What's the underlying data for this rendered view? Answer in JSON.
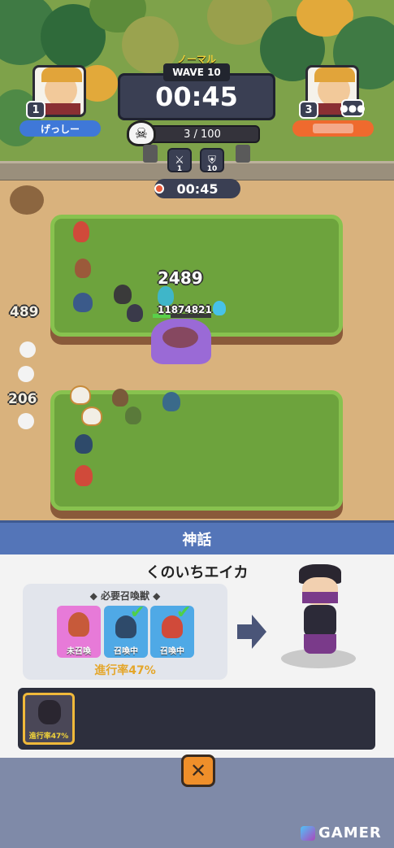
{
  "player1": {
    "name": "げっしー",
    "level": "1"
  },
  "player2": {
    "level": "3"
  },
  "hud": {
    "mode": "ノーマル",
    "wave": "WAVE 10",
    "timer": "00:45",
    "enemy_count": "3 / 100",
    "attack_level": "1",
    "defense_level": "10",
    "sub_timer": "00:45",
    "boss_hp": "11874821"
  },
  "effects": {
    "damage_1": "2489",
    "damage_2": "489",
    "damage_3": "206"
  },
  "panel": {
    "title": "神話",
    "unit_name": "くのいちエイカ",
    "required_label": "必要召喚獣",
    "slots": [
      {
        "status": "未召喚"
      },
      {
        "status": "召喚中"
      },
      {
        "status": "召喚中"
      }
    ],
    "progress": "進行率47%",
    "collection_progress": "進行率47%"
  },
  "watermark": "GAMER"
}
